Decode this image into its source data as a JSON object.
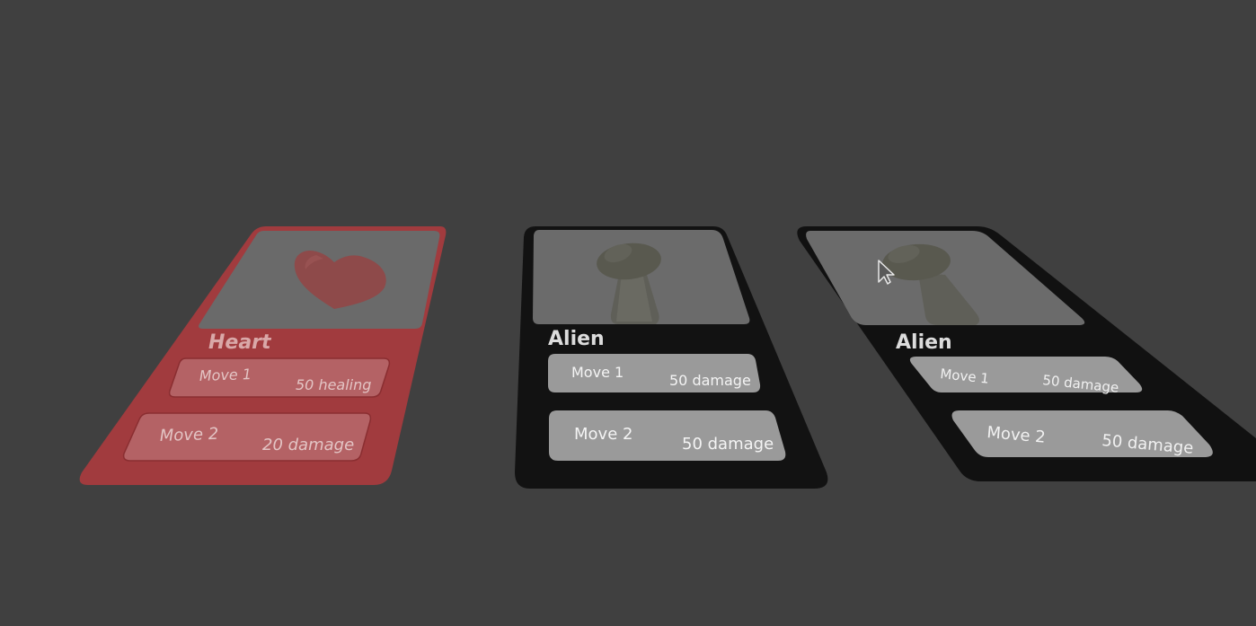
{
  "cards": [
    {
      "name": "Heart",
      "moves": [
        {
          "label": "Move 1",
          "value": "50 healing"
        },
        {
          "label": "Move 2",
          "value": "20 damage"
        }
      ],
      "color": "#a23c3f"
    },
    {
      "name": "Alien",
      "moves": [
        {
          "label": "Move 1",
          "value": "50 damage"
        },
        {
          "label": "Move 2",
          "value": "50 damage"
        }
      ],
      "color": "#121212"
    },
    {
      "name": "Alien",
      "moves": [
        {
          "label": "Move 1",
          "value": "50 damage"
        },
        {
          "label": "Move 2",
          "value": "50 damage"
        }
      ],
      "color": "#111111"
    }
  ],
  "background_color": "#404040",
  "cursor": {
    "icon": "mouse-pointer-icon"
  }
}
